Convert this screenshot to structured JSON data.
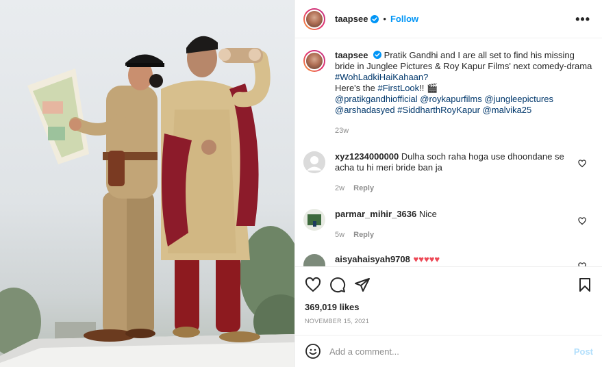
{
  "post": {
    "photo_alt": "Two people in costume on a rooftop, one in a police uniform reading a map, one in a sherwani with binoculars"
  },
  "header": {
    "username": "taapsee",
    "separator": "•",
    "follow_label": "Follow",
    "more_label": "•••"
  },
  "caption": {
    "username": "taapsee",
    "text": "Pratik Gandhi and I are all set to find his missing bride in Junglee Pictures & Roy Kapur Films' next comedy-drama",
    "hashtag1": "#WohLadkiHaiKahaan?",
    "line2_prefix": "Here's the",
    "hashtag2": "#FirstLook",
    "line2_suffix": "!! 🎬",
    "mentions_line1": "@pratikgandhiofficial @roykapurfilms @jungleepictures",
    "mentions_line2": "@arshadasyed #SiddharthRoyKapur @malvika25",
    "time": "23w"
  },
  "comments": [
    {
      "username": "xyz1234000000",
      "text": "Dulha soch raha hoga use dhoondane se acha tu hi meri bride ban ja",
      "time": "2w",
      "reply": "Reply"
    },
    {
      "username": "parmar_mihir_3636",
      "text": "Nice",
      "time": "5w",
      "reply": "Reply"
    },
    {
      "username": "aisyahaisyah9708",
      "text": "♥♥♥♥♥"
    }
  ],
  "actions": {
    "likes": "369,019 likes",
    "date": "NOVEMBER 15, 2021"
  },
  "add_comment": {
    "placeholder": "Add a comment...",
    "post_label": "Post"
  },
  "colors": {
    "accent": "#0095f6",
    "link": "#00376b",
    "muted": "#8e8e8e",
    "like_red": "#ed4956",
    "post_disabled": "#b2dffc"
  }
}
